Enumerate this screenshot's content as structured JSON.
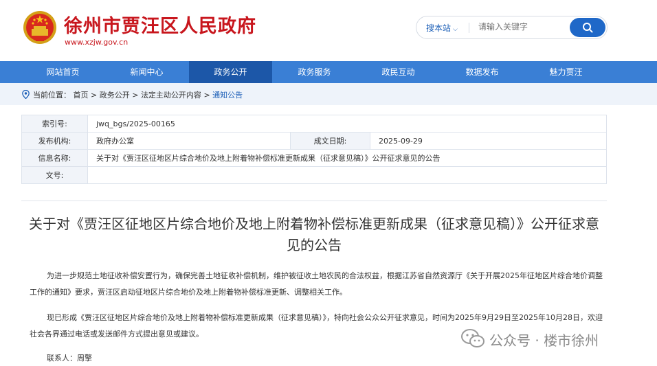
{
  "header": {
    "title": "徐州市贾汪区人民政府",
    "url": "www.xzjw.gov.cn",
    "emblem_icon": "national-emblem-icon"
  },
  "search": {
    "scope_label": "搜本站",
    "placeholder": "请输入关键字",
    "button_icon": "search-icon"
  },
  "nav": {
    "items": [
      "网站首页",
      "新闻中心",
      "政务公开",
      "政务服务",
      "政民互动",
      "数据发布",
      "魅力贾汪"
    ],
    "active_index": 2
  },
  "breadcrumb": {
    "prefix": "当前位置：",
    "items": [
      "首页",
      "政务公开",
      "法定主动公开内容",
      "通知公告"
    ],
    "separator": ">"
  },
  "meta": {
    "index_label": "索引号:",
    "index_value": "jwq_bgs/2025-00165",
    "publisher_label": "发布机构:",
    "publisher_value": "政府办公室",
    "date_label": "成文日期:",
    "date_value": "2025-09-29",
    "info_label": "信息名称:",
    "info_value": "关于对《贾汪区征地区片综合地价及地上附着物补偿标准更新成果（征求意见稿）》公开征求意见的公告",
    "docno_label": "文号:",
    "docno_value": ""
  },
  "article": {
    "title": "关于对《贾汪区征地区片综合地价及地上附着物补偿标准更新成果（征求意见稿）》公开征求意见的公告",
    "para1": "为进一步规范土地征收补偿安置行为，确保完善土地征收补偿机制，维护被征收土地农民的合法权益，根据江苏省自然资源厅《关于开展2025年征地区片综合地价调整工作的通知》要求，贾汪区启动征地区片综合地价及地上附着物补偿标准更新、调整相关工作。",
    "para2": "现已形成《贾汪区征地区片综合地价及地上附着物补偿标准更新成果（征求意见稿）》，特向社会公众公开征求意见，时间为2025年9月29日至2025年10月28日，欢迎社会各界通过电话或发送邮件方式提出意见或建议。",
    "contact": "联系人：周擎"
  },
  "watermark": {
    "text": "公众号 · 楼市徐州",
    "icon": "wechat-icon"
  },
  "colors": {
    "brand_red": "#c8161d",
    "nav_blue": "#3a7fd5",
    "nav_active": "#1c57a8",
    "link_blue": "#1c5fb7"
  }
}
